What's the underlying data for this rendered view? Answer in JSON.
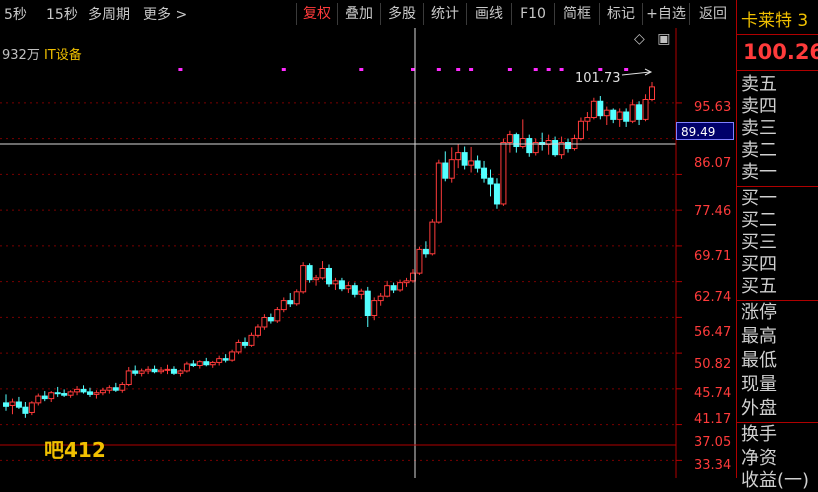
{
  "toolbar": {
    "left_items": [
      "5秒",
      "15秒",
      "多周期",
      "更多 >"
    ],
    "buttons": [
      "复权",
      "叠加",
      "多股",
      "统计",
      "画线",
      "F10",
      "简框",
      "标记",
      "+自选",
      "返回"
    ],
    "active_button": "复权"
  },
  "chart": {
    "volume_label": "932万",
    "industry_label": "IT设备",
    "bottom_label": "吧412",
    "max_label": "101.73",
    "crosshair_price": "89.49",
    "y_axis": [
      "95.63",
      "86.07",
      "77.46",
      "69.71",
      "62.74",
      "56.47",
      "50.82",
      "45.74",
      "41.17",
      "37.05",
      "33.34"
    ]
  },
  "sidebar": {
    "name": "卡莱特 3",
    "price": "100.26",
    "sell_rows": [
      "卖五",
      "卖四",
      "卖三",
      "卖二",
      "卖一"
    ],
    "buy_rows": [
      "买一",
      "买二",
      "买三",
      "买四",
      "买五"
    ],
    "stat_rows": [
      "涨停",
      "最高",
      "最低",
      "现量",
      "外盘"
    ],
    "extra_rows": [
      "换手",
      "净资",
      "收益(一)"
    ]
  },
  "chart_data": {
    "type": "candlestick",
    "y_scale": "log",
    "ylim": [
      32.6,
      106
    ],
    "candles": [
      {
        "o": 39.5,
        "h": 40.5,
        "l": 38.6,
        "c": 39.1
      },
      {
        "o": 39.2,
        "h": 40.0,
        "l": 38.2,
        "c": 39.6
      },
      {
        "o": 39.6,
        "h": 40.2,
        "l": 38.8,
        "c": 39.0
      },
      {
        "o": 39.0,
        "h": 39.6,
        "l": 37.8,
        "c": 38.3
      },
      {
        "o": 38.4,
        "h": 39.7,
        "l": 38.1,
        "c": 39.5
      },
      {
        "o": 39.5,
        "h": 40.6,
        "l": 39.2,
        "c": 40.3
      },
      {
        "o": 40.3,
        "h": 40.9,
        "l": 39.7,
        "c": 40.0
      },
      {
        "o": 40.0,
        "h": 40.9,
        "l": 39.6,
        "c": 40.7
      },
      {
        "o": 40.7,
        "h": 41.4,
        "l": 40.2,
        "c": 40.6
      },
      {
        "o": 40.6,
        "h": 41.1,
        "l": 40.2,
        "c": 40.4
      },
      {
        "o": 40.4,
        "h": 41.0,
        "l": 40.1,
        "c": 40.8
      },
      {
        "o": 40.8,
        "h": 41.5,
        "l": 40.4,
        "c": 41.1
      },
      {
        "o": 41.1,
        "h": 41.6,
        "l": 40.6,
        "c": 40.8
      },
      {
        "o": 40.8,
        "h": 41.3,
        "l": 40.2,
        "c": 40.5
      },
      {
        "o": 40.5,
        "h": 41.0,
        "l": 40.0,
        "c": 40.7
      },
      {
        "o": 40.7,
        "h": 41.3,
        "l": 40.4,
        "c": 41.0
      },
      {
        "o": 41.0,
        "h": 41.6,
        "l": 40.6,
        "c": 41.3
      },
      {
        "o": 41.3,
        "h": 41.9,
        "l": 40.8,
        "c": 41.0
      },
      {
        "o": 41.0,
        "h": 42.0,
        "l": 40.7,
        "c": 41.7
      },
      {
        "o": 41.7,
        "h": 43.9,
        "l": 41.5,
        "c": 43.4
      },
      {
        "o": 43.4,
        "h": 44.1,
        "l": 42.8,
        "c": 43.1
      },
      {
        "o": 43.1,
        "h": 43.7,
        "l": 42.7,
        "c": 43.4
      },
      {
        "o": 43.4,
        "h": 44.0,
        "l": 43.0,
        "c": 43.6
      },
      {
        "o": 43.6,
        "h": 44.1,
        "l": 43.1,
        "c": 43.3
      },
      {
        "o": 43.3,
        "h": 43.9,
        "l": 43.0,
        "c": 43.5
      },
      {
        "o": 43.5,
        "h": 44.2,
        "l": 43.0,
        "c": 43.6
      },
      {
        "o": 43.6,
        "h": 44.0,
        "l": 42.9,
        "c": 43.1
      },
      {
        "o": 43.1,
        "h": 43.6,
        "l": 42.7,
        "c": 43.4
      },
      {
        "o": 43.4,
        "h": 44.6,
        "l": 43.2,
        "c": 44.3
      },
      {
        "o": 44.3,
        "h": 44.8,
        "l": 43.9,
        "c": 44.1
      },
      {
        "o": 44.1,
        "h": 44.8,
        "l": 43.7,
        "c": 44.6
      },
      {
        "o": 44.6,
        "h": 45.1,
        "l": 44.0,
        "c": 44.2
      },
      {
        "o": 44.2,
        "h": 44.7,
        "l": 43.8,
        "c": 44.5
      },
      {
        "o": 44.5,
        "h": 45.4,
        "l": 44.1,
        "c": 45.0
      },
      {
        "o": 45.0,
        "h": 45.6,
        "l": 44.5,
        "c": 44.8
      },
      {
        "o": 44.8,
        "h": 46.2,
        "l": 44.6,
        "c": 45.9
      },
      {
        "o": 45.9,
        "h": 47.6,
        "l": 45.6,
        "c": 47.2
      },
      {
        "o": 47.2,
        "h": 47.9,
        "l": 46.4,
        "c": 46.8
      },
      {
        "o": 46.8,
        "h": 48.6,
        "l": 46.6,
        "c": 48.2
      },
      {
        "o": 48.2,
        "h": 49.8,
        "l": 47.9,
        "c": 49.4
      },
      {
        "o": 49.4,
        "h": 51.3,
        "l": 49.0,
        "c": 50.8
      },
      {
        "o": 50.8,
        "h": 51.4,
        "l": 49.9,
        "c": 50.3
      },
      {
        "o": 50.3,
        "h": 52.4,
        "l": 50.0,
        "c": 52.0
      },
      {
        "o": 52.0,
        "h": 53.9,
        "l": 51.6,
        "c": 53.4
      },
      {
        "o": 53.4,
        "h": 54.6,
        "l": 52.4,
        "c": 52.9
      },
      {
        "o": 52.9,
        "h": 55.2,
        "l": 52.6,
        "c": 54.8
      },
      {
        "o": 54.8,
        "h": 59.8,
        "l": 54.5,
        "c": 59.2
      },
      {
        "o": 59.2,
        "h": 59.6,
        "l": 56.3,
        "c": 56.8
      },
      {
        "o": 56.8,
        "h": 57.6,
        "l": 55.8,
        "c": 57.1
      },
      {
        "o": 57.1,
        "h": 60.0,
        "l": 56.8,
        "c": 58.7
      },
      {
        "o": 58.7,
        "h": 59.4,
        "l": 55.6,
        "c": 56.1
      },
      {
        "o": 56.1,
        "h": 57.1,
        "l": 55.1,
        "c": 56.6
      },
      {
        "o": 56.6,
        "h": 57.1,
        "l": 54.9,
        "c": 55.3
      },
      {
        "o": 55.3,
        "h": 56.4,
        "l": 54.6,
        "c": 55.8
      },
      {
        "o": 55.8,
        "h": 56.3,
        "l": 53.9,
        "c": 54.4
      },
      {
        "o": 54.4,
        "h": 55.3,
        "l": 53.6,
        "c": 54.9
      },
      {
        "o": 54.9,
        "h": 55.6,
        "l": 49.4,
        "c": 51.1
      },
      {
        "o": 51.1,
        "h": 53.9,
        "l": 50.4,
        "c": 53.4
      },
      {
        "o": 53.4,
        "h": 54.6,
        "l": 52.6,
        "c": 54.1
      },
      {
        "o": 54.1,
        "h": 56.6,
        "l": 53.9,
        "c": 55.8
      },
      {
        "o": 55.8,
        "h": 56.3,
        "l": 54.6,
        "c": 55.1
      },
      {
        "o": 55.1,
        "h": 56.8,
        "l": 54.8,
        "c": 56.3
      },
      {
        "o": 56.3,
        "h": 57.1,
        "l": 55.6,
        "c": 56.6
      },
      {
        "o": 56.6,
        "h": 58.6,
        "l": 56.3,
        "c": 57.9
      },
      {
        "o": 57.9,
        "h": 62.6,
        "l": 57.6,
        "c": 62.1
      },
      {
        "o": 62.1,
        "h": 63.6,
        "l": 60.6,
        "c": 61.3
      },
      {
        "o": 61.3,
        "h": 67.9,
        "l": 61.0,
        "c": 67.3
      },
      {
        "o": 67.3,
        "h": 80.9,
        "l": 67.0,
        "c": 80.1
      },
      {
        "o": 80.1,
        "h": 82.9,
        "l": 75.9,
        "c": 76.6
      },
      {
        "o": 76.6,
        "h": 83.9,
        "l": 75.6,
        "c": 80.9
      },
      {
        "o": 80.9,
        "h": 84.6,
        "l": 78.9,
        "c": 82.6
      },
      {
        "o": 82.6,
        "h": 84.1,
        "l": 78.6,
        "c": 79.6
      },
      {
        "o": 79.6,
        "h": 84.0,
        "l": 77.9,
        "c": 80.6
      },
      {
        "o": 80.6,
        "h": 81.9,
        "l": 77.9,
        "c": 78.9
      },
      {
        "o": 78.9,
        "h": 80.6,
        "l": 75.6,
        "c": 76.6
      },
      {
        "o": 76.6,
        "h": 78.6,
        "l": 72.6,
        "c": 75.3
      },
      {
        "o": 75.3,
        "h": 76.6,
        "l": 70.0,
        "c": 71.0
      },
      {
        "o": 71.0,
        "h": 86.1,
        "l": 70.6,
        "c": 85.1
      },
      {
        "o": 85.1,
        "h": 88.1,
        "l": 82.6,
        "c": 87.1
      },
      {
        "o": 87.1,
        "h": 87.6,
        "l": 82.6,
        "c": 84.1
      },
      {
        "o": 84.1,
        "h": 91.1,
        "l": 83.6,
        "c": 86.1
      },
      {
        "o": 86.1,
        "h": 87.1,
        "l": 81.6,
        "c": 82.6
      },
      {
        "o": 82.6,
        "h": 86.1,
        "l": 81.9,
        "c": 85.1
      },
      {
        "o": 85.1,
        "h": 87.6,
        "l": 83.1,
        "c": 84.6
      },
      {
        "o": 84.6,
        "h": 87.1,
        "l": 82.1,
        "c": 85.6
      },
      {
        "o": 85.6,
        "h": 86.6,
        "l": 81.6,
        "c": 82.1
      },
      {
        "o": 82.1,
        "h": 86.6,
        "l": 81.1,
        "c": 85.1
      },
      {
        "o": 85.1,
        "h": 86.1,
        "l": 82.6,
        "c": 83.6
      },
      {
        "o": 83.6,
        "h": 87.1,
        "l": 83.1,
        "c": 86.1
      },
      {
        "o": 86.1,
        "h": 91.6,
        "l": 85.6,
        "c": 90.6
      },
      {
        "o": 90.6,
        "h": 93.1,
        "l": 88.1,
        "c": 91.6
      },
      {
        "o": 91.6,
        "h": 97.1,
        "l": 91.1,
        "c": 96.1
      },
      {
        "o": 96.1,
        "h": 97.6,
        "l": 91.1,
        "c": 92.1
      },
      {
        "o": 92.1,
        "h": 94.6,
        "l": 89.6,
        "c": 93.6
      },
      {
        "o": 93.6,
        "h": 94.1,
        "l": 90.1,
        "c": 91.1
      },
      {
        "o": 91.1,
        "h": 94.1,
        "l": 89.1,
        "c": 93.1
      },
      {
        "o": 93.1,
        "h": 94.1,
        "l": 89.1,
        "c": 90.6
      },
      {
        "o": 90.6,
        "h": 96.6,
        "l": 90.1,
        "c": 95.1
      },
      {
        "o": 95.1,
        "h": 96.1,
        "l": 89.6,
        "c": 91.1
      },
      {
        "o": 91.1,
        "h": 98.1,
        "l": 90.6,
        "c": 96.6
      },
      {
        "o": 96.6,
        "h": 101.73,
        "l": 96.1,
        "c": 100.26
      }
    ],
    "markers_x": [
      27,
      43,
      55,
      63,
      67,
      70,
      72,
      78,
      82,
      84,
      86,
      92,
      96
    ]
  }
}
